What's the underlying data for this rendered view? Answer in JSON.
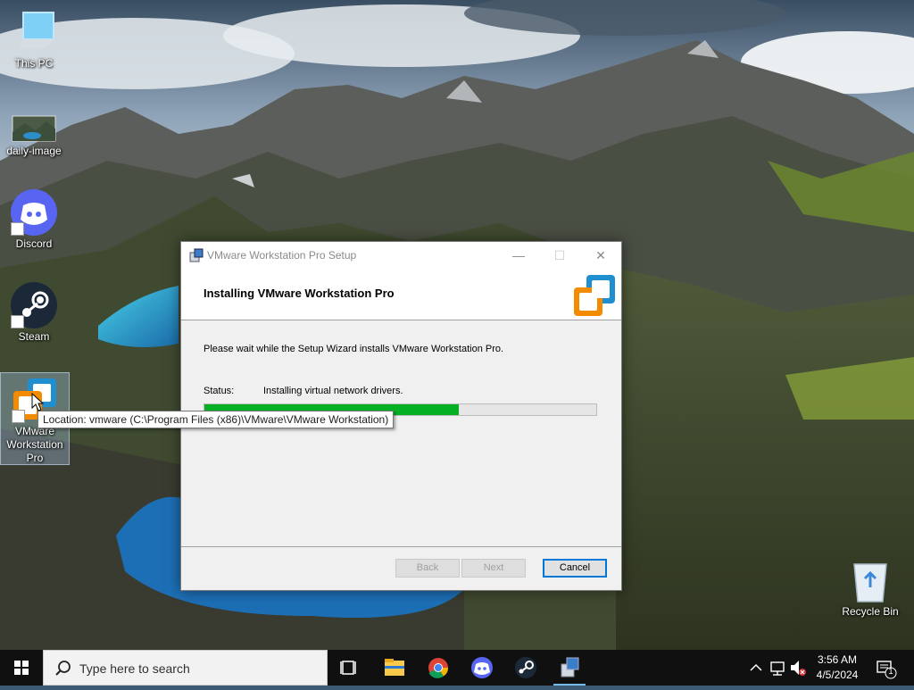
{
  "desktop": {
    "icons": [
      {
        "label": "This PC"
      },
      {
        "label": "daily-image"
      },
      {
        "label": "Discord"
      },
      {
        "label": "Steam"
      },
      {
        "label": "VMware Workstation Pro"
      },
      {
        "label": "Recycle Bin"
      }
    ],
    "tooltip": "Location: vmware (C:\\Program Files (x86)\\VMware\\VMware Workstation)"
  },
  "window": {
    "title": "VMware Workstation Pro Setup",
    "controls": {
      "minimize": "—",
      "maximize": "☐",
      "close": "✕"
    },
    "heading": "Installing VMware Workstation Pro",
    "intro": "Please wait while the Setup Wizard installs VMware Workstation Pro.",
    "status_label": "Status:",
    "status_value": "Installing virtual network drivers.",
    "progress": 0.65,
    "buttons": {
      "back": "Back",
      "next": "Next",
      "cancel": "Cancel"
    }
  },
  "taskbar": {
    "search_placeholder": "Type here to search",
    "apps": [
      "task-view",
      "file-explorer",
      "chrome",
      "discord",
      "steam",
      "vmware-setup"
    ],
    "clock": {
      "time": "3:56 AM",
      "date": "4/5/2024"
    },
    "notification_count": "1"
  },
  "colors": {
    "accent": "#0078d7",
    "progress": "#06b025",
    "taskbar": "#101010"
  }
}
